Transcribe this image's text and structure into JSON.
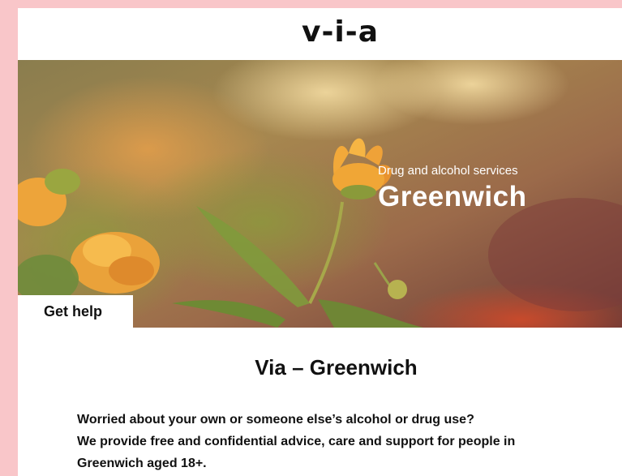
{
  "header": {
    "logo": "v-i-a"
  },
  "hero": {
    "subtitle": "Drug and alcohol services",
    "title": "Greenwich",
    "get_help_label": "Get help"
  },
  "content": {
    "title": "Via – Greenwich",
    "line1": "Worried about your own or someone else’s alcohol or drug use?",
    "line2": "We provide free and confidential advice, care and support for people in",
    "line3": "Greenwich aged 18+."
  }
}
